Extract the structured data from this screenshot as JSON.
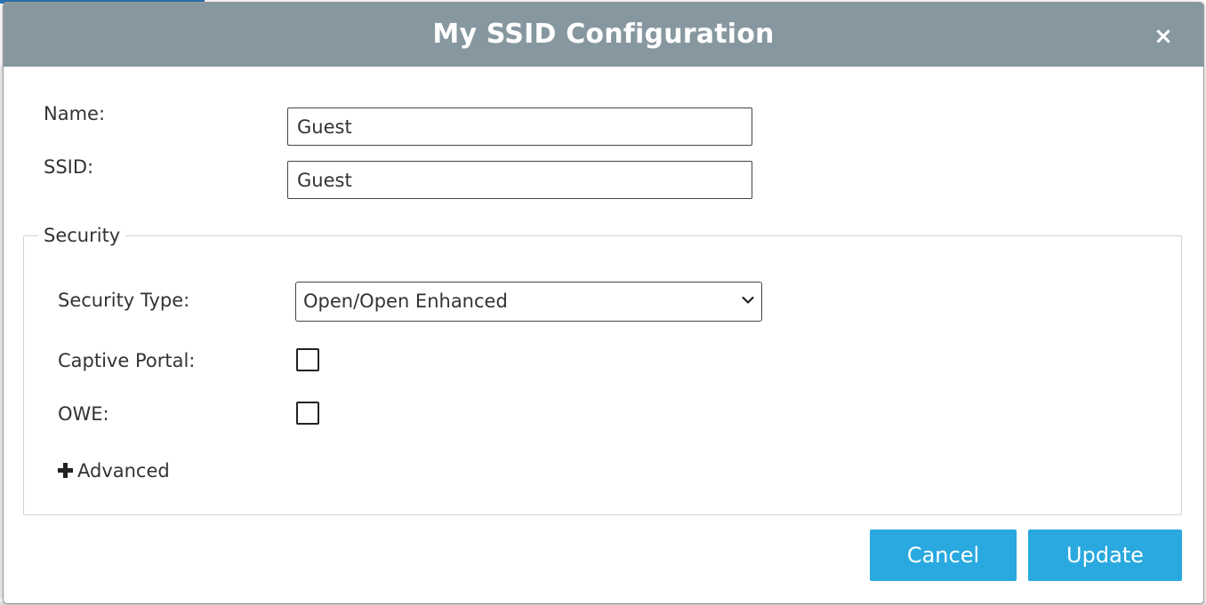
{
  "dialog": {
    "title": "My SSID Configuration",
    "close_label": "×"
  },
  "form": {
    "name_label": "Name:",
    "name_value": "Guest",
    "ssid_label": "SSID:",
    "ssid_value": "Guest"
  },
  "security": {
    "legend": "Security",
    "type_label": "Security Type:",
    "type_value": "Open/Open Enhanced",
    "captive_portal_label": "Captive Portal:",
    "captive_portal_checked": false,
    "owe_label": "OWE:",
    "owe_checked": false,
    "advanced_label": "Advanced"
  },
  "footer": {
    "cancel_label": "Cancel",
    "update_label": "Update"
  },
  "colors": {
    "header_bg": "#86979f",
    "button_bg": "#29a9df"
  },
  "icons": [
    "close-icon",
    "chevron-down-icon",
    "plus-icon"
  ]
}
